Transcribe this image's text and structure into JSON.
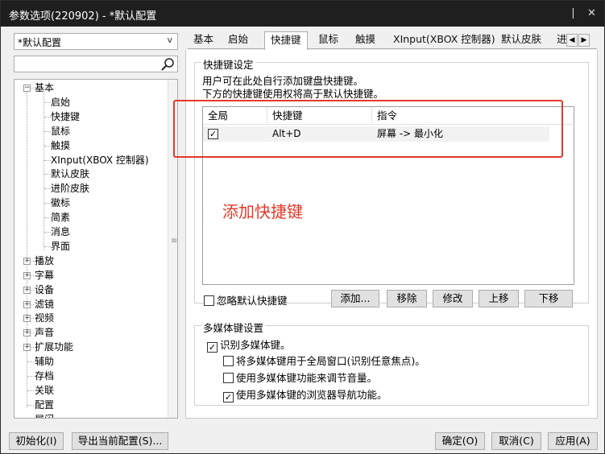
{
  "window": {
    "title": "参数选项(220902) - *默认配置",
    "pin_icon": "pin-icon",
    "close_icon": "close-icon"
  },
  "sidebar": {
    "profile_select": "*默认配置",
    "search_placeholder": "",
    "tree": [
      {
        "label": "基本",
        "expanded": true
      },
      {
        "label": "启始"
      },
      {
        "label": "快捷键"
      },
      {
        "label": "鼠标"
      },
      {
        "label": "触摸"
      },
      {
        "label": "XInput(XBOX 控制器)"
      },
      {
        "label": "默认皮肤"
      },
      {
        "label": "进阶皮肤"
      },
      {
        "label": "徽标"
      },
      {
        "label": "简素"
      },
      {
        "label": "消息"
      },
      {
        "label": "界面"
      },
      {
        "label": "播放",
        "expanded": false
      },
      {
        "label": "字幕",
        "expanded": false
      },
      {
        "label": "设备",
        "expanded": false
      },
      {
        "label": "滤镜",
        "expanded": false
      },
      {
        "label": "视频",
        "expanded": false
      },
      {
        "label": "声音",
        "expanded": false
      },
      {
        "label": "扩展功能",
        "expanded": false
      },
      {
        "label": "辅助"
      },
      {
        "label": "存档"
      },
      {
        "label": "关联"
      },
      {
        "label": "配置"
      },
      {
        "label": "展闪"
      }
    ]
  },
  "tabs": [
    "基本",
    "启始",
    "快捷键",
    "鼠标",
    "触摸",
    "XInput(XBOX 控制器)",
    "默认皮肤",
    "进"
  ],
  "active_tab": "快捷键",
  "hotkeys": {
    "group_title": "快捷键设定",
    "desc_line1": "用户可在此处自行添加键盘快捷键。",
    "desc_line2": "下方的快捷键使用权将高于默认快捷键。",
    "columns": [
      "全局",
      "快捷键",
      "指令"
    ],
    "rows": [
      {
        "global": true,
        "key": "Alt+D",
        "command": "屏幕 -> 最小化"
      }
    ],
    "annotation": "添加快捷键",
    "ignore_default": "忽略默认快捷键",
    "buttons": {
      "add": "添加...",
      "remove": "移除",
      "modify": "修改",
      "up": "上移",
      "down": "下移"
    }
  },
  "multimedia": {
    "group_title": "多媒体键设置",
    "recognize": "识别多媒体键。",
    "option1": "将多媒体键用于全局窗口(识别任意焦点)。",
    "option2": "使用多媒体键功能来调节音量。",
    "option3": "使用多媒体键的浏览器导航功能。",
    "recognize_checked": true,
    "option1_checked": false,
    "option2_checked": false,
    "option3_checked": true
  },
  "footer": {
    "init": "初始化(I)",
    "export": "导出当前配置(S)...",
    "ok": "确定(O)",
    "cancel": "取消(C)",
    "apply": "应用(A)"
  },
  "colors": {
    "annotation_red": "#e23a2a",
    "titlebar": "#1f1f1f"
  }
}
